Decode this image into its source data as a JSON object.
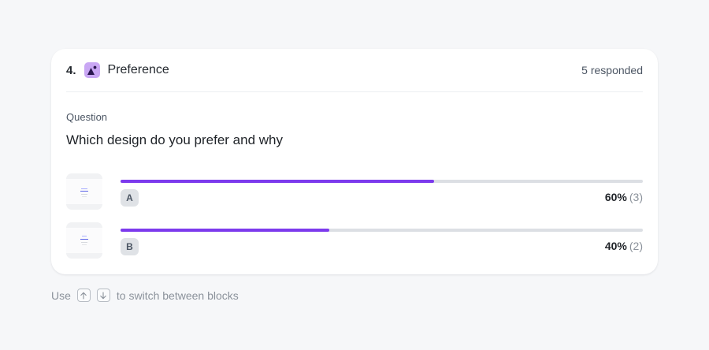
{
  "block": {
    "number": "4.",
    "type_icon": "image-icon",
    "type_color": "#c9a7f4",
    "title": "Preference",
    "responded": "5 responded"
  },
  "question": {
    "label": "Question",
    "text": "Which design do you prefer and why"
  },
  "accent_color": "#7c3aed",
  "options": [
    {
      "letter": "A",
      "percent_value": 60,
      "percent": "60%",
      "count": "(3)"
    },
    {
      "letter": "B",
      "percent_value": 40,
      "percent": "40%",
      "count": "(2)"
    }
  ],
  "hint": {
    "prefix": "Use",
    "up_icon": "arrow-up-icon",
    "down_icon": "arrow-down-icon",
    "suffix": "to switch between blocks"
  }
}
